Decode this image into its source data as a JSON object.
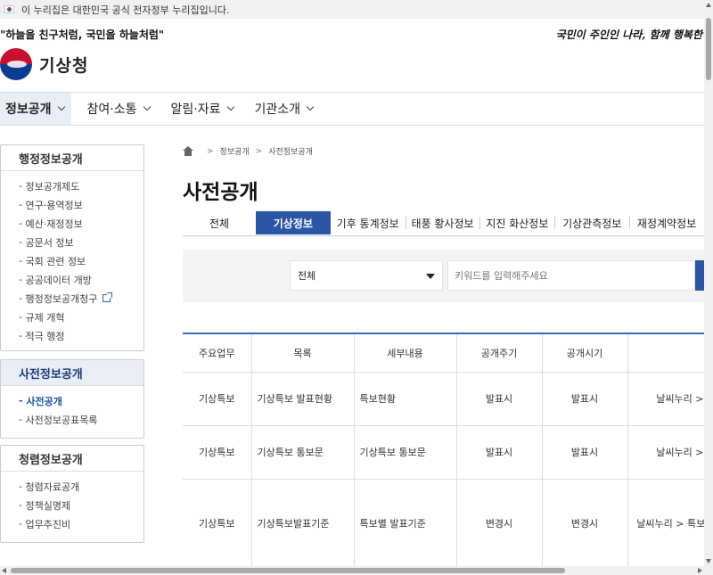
{
  "banner": {
    "text": "이 누리집은 대한민국 공식 전자정부 누리집입니다."
  },
  "header": {
    "slogan_left": "\"하늘을 친구처럼, 국민을 하늘처럼\"",
    "slogan_right": "국민이 주인인 나라, 함께 행복한",
    "logo_text": "기상청"
  },
  "gnb": [
    {
      "label": "정보공개",
      "active": true
    },
    {
      "label": "참여·소통"
    },
    {
      "label": "알림·자료"
    },
    {
      "label": "기관소개"
    }
  ],
  "sidebar": {
    "groups": [
      {
        "title": "행정정보공개",
        "items": [
          "정보공개제도",
          "연구·용역정보",
          "예산·재정정보",
          "공문서 정보",
          "국회 관련 정보",
          "공공데이터 개방",
          "행정정보공개청구",
          "규제 개혁",
          "적극 행정"
        ]
      },
      {
        "title": "사전정보공개",
        "items": [
          "사전공개",
          "사전정보공표목록"
        ]
      },
      {
        "title": "청렴정보공개",
        "items": [
          "청렴자료공개",
          "정책실명제",
          "업무추진비"
        ]
      }
    ]
  },
  "breadcrumb": [
    "정보공개",
    "사전정보공개"
  ],
  "page_title": "사전공개",
  "tabs": [
    "전체",
    "기상정보",
    "기후 통계정보",
    "태풍 황사정보",
    "지진 화산정보",
    "기상관측정보",
    "재정계약정보"
  ],
  "search": {
    "select_value": "전체",
    "placeholder": "키워드를 입력해주세요"
  },
  "table": {
    "headers": [
      "주요업무",
      "목록",
      "세부내용",
      "공개주기",
      "공개시기",
      ""
    ],
    "rows": [
      [
        "기상특보",
        "기상특보 발표현황",
        "특보현황",
        "발표시",
        "발표시",
        "날씨누리 > 특보"
      ],
      [
        "기상특보",
        "기상특보 통보문",
        "기상특보 통보문",
        "발표시",
        "발표시",
        "날씨누리 > 특보"
      ],
      [
        "기상특보",
        "기상특보발표기준",
        "특보별 발표기준",
        "변경시",
        "변경시",
        "날씨누리 > 특보 기상특보"
      ]
    ]
  }
}
